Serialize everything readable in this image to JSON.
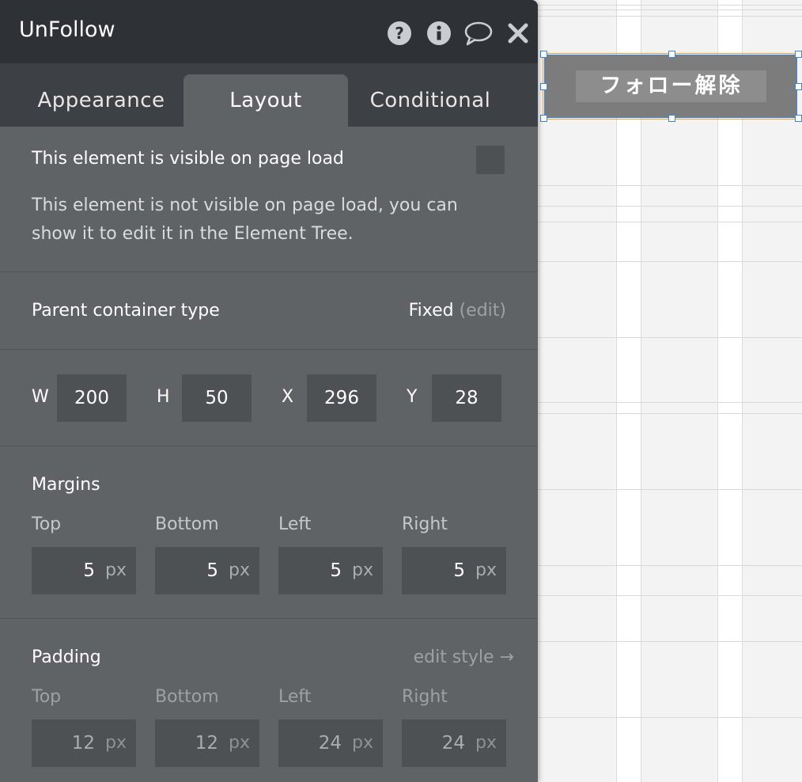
{
  "panel": {
    "title": "UnFollow",
    "header_icons": [
      "help-icon",
      "info-icon",
      "comment-icon",
      "close-icon"
    ],
    "tabs": [
      {
        "label": "Appearance",
        "active": false
      },
      {
        "label": "Layout",
        "active": true
      },
      {
        "label": "Conditional",
        "active": false
      }
    ]
  },
  "visibility": {
    "label": "This element is visible on page load",
    "checked": false,
    "description": "This element is not visible on page load, you can show it to edit it in the Element Tree."
  },
  "parent_container": {
    "label": "Parent container type",
    "value": "Fixed",
    "edit_label": "(edit)"
  },
  "dimensions": {
    "w_label": "W",
    "w_value": "200",
    "h_label": "H",
    "h_value": "50",
    "x_label": "X",
    "x_value": "296",
    "y_label": "Y",
    "y_value": "28"
  },
  "margins": {
    "title": "Margins",
    "unit": "px",
    "top_label": "Top",
    "top_value": "5",
    "bottom_label": "Bottom",
    "bottom_value": "5",
    "left_label": "Left",
    "left_value": "5",
    "right_label": "Right",
    "right_value": "5"
  },
  "padding": {
    "title": "Padding",
    "edit_style_label": "edit style →",
    "unit": "px",
    "top_label": "Top",
    "top_value": "12",
    "bottom_label": "Bottom",
    "bottom_value": "12",
    "left_label": "Left",
    "left_value": "24",
    "right_label": "Right",
    "right_value": "24"
  },
  "canvas": {
    "selected_button_label": "フォロー解除",
    "colors": {
      "selection_border": "#3c86d8",
      "outer_border": "#f0a23a",
      "button_bg": "#7c7c7c"
    }
  }
}
